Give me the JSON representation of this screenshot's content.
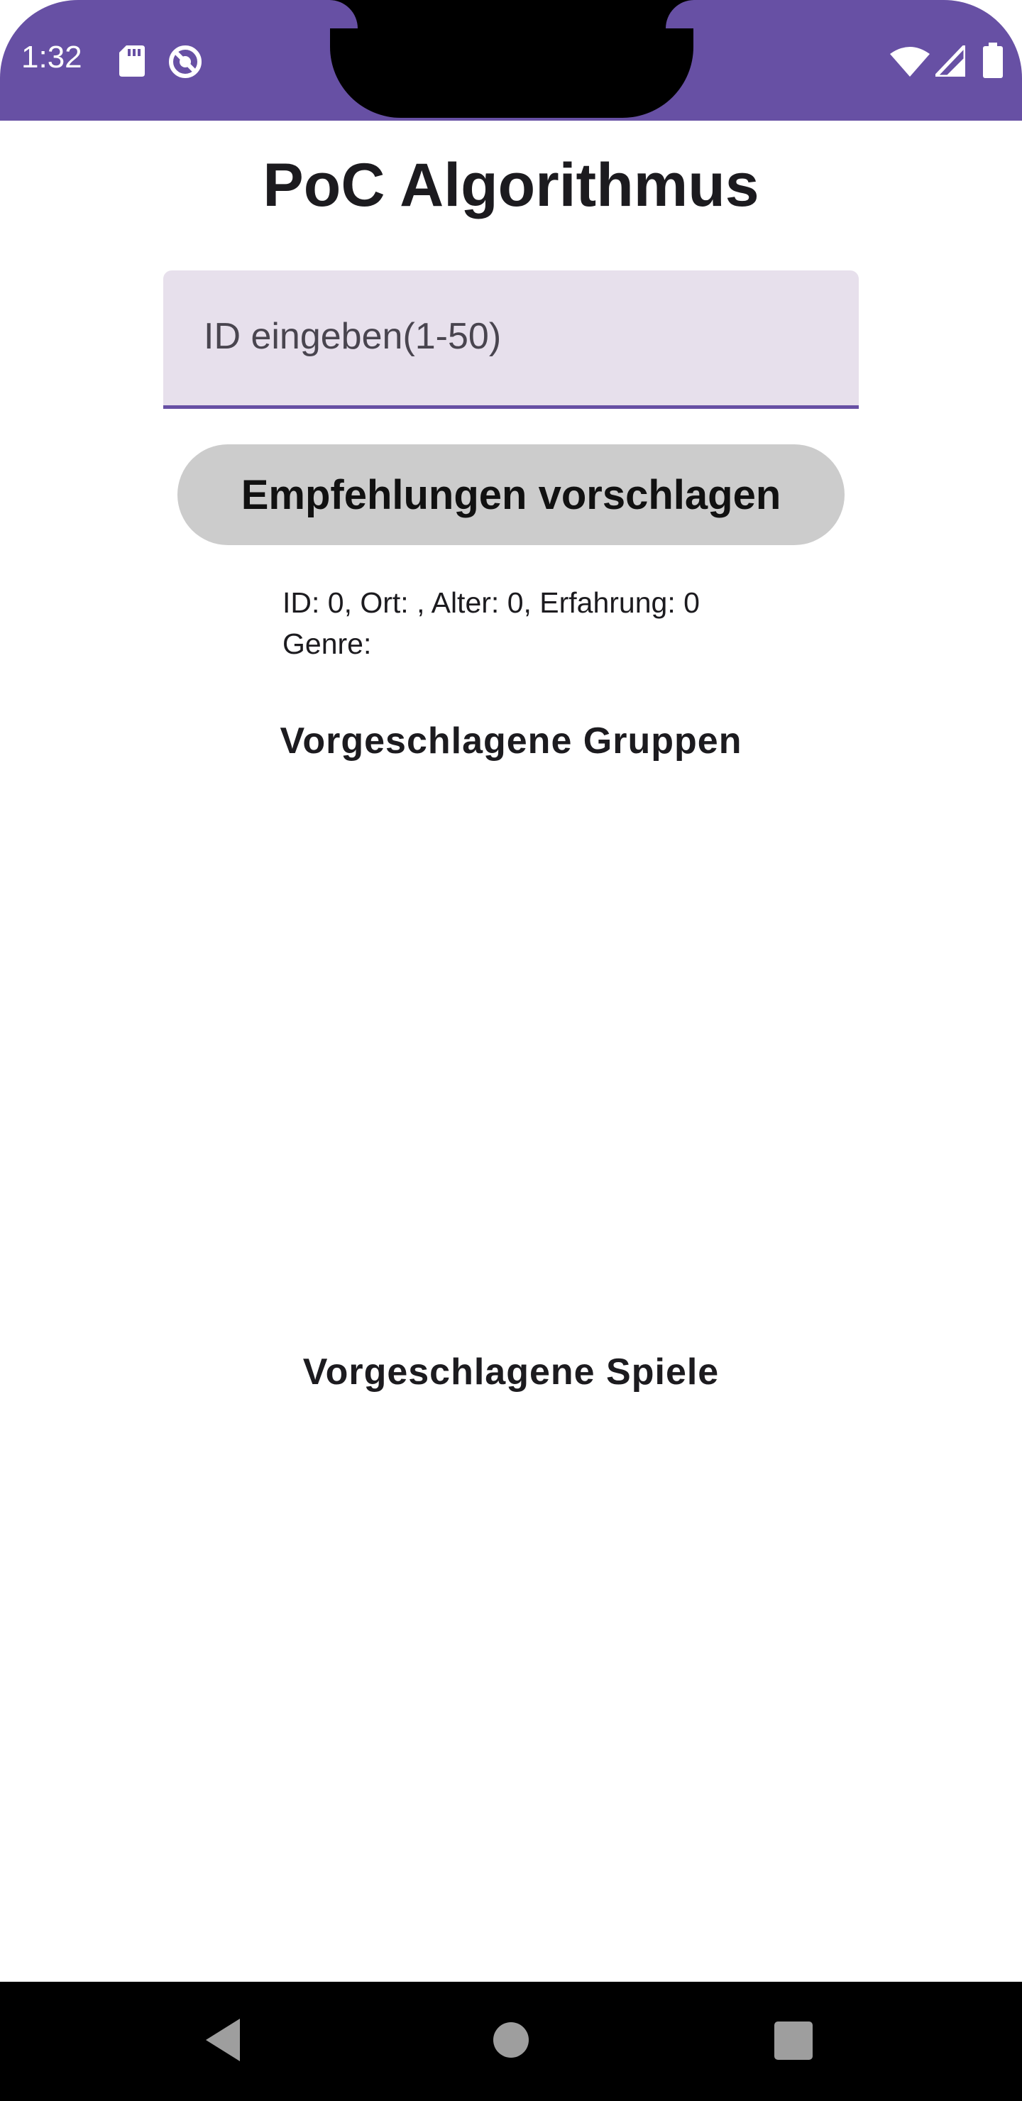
{
  "status_bar": {
    "time": "1:32",
    "background_color": "#6750a4",
    "icons": [
      "sd-card-icon",
      "data-saver-icon",
      "wifi-icon",
      "signal-icon",
      "battery-icon"
    ]
  },
  "app": {
    "title": "PoC Algorithmus",
    "accent_color": "#6750a4"
  },
  "id_input": {
    "label": "ID eingeben(1-50)",
    "value": ""
  },
  "recommend_button": {
    "label": "Empfehlungen vorschlagen"
  },
  "user_info": {
    "line1": "ID: 0, Ort: , Alter: 0, Erfahrung: 0",
    "line2": "Genre:"
  },
  "sections": {
    "groups_title": "Vorgeschlagene Gruppen",
    "games_title": "Vorgeschlagene Spiele"
  },
  "nav_bar": {
    "buttons": [
      "back-icon",
      "home-icon",
      "recents-icon"
    ]
  }
}
